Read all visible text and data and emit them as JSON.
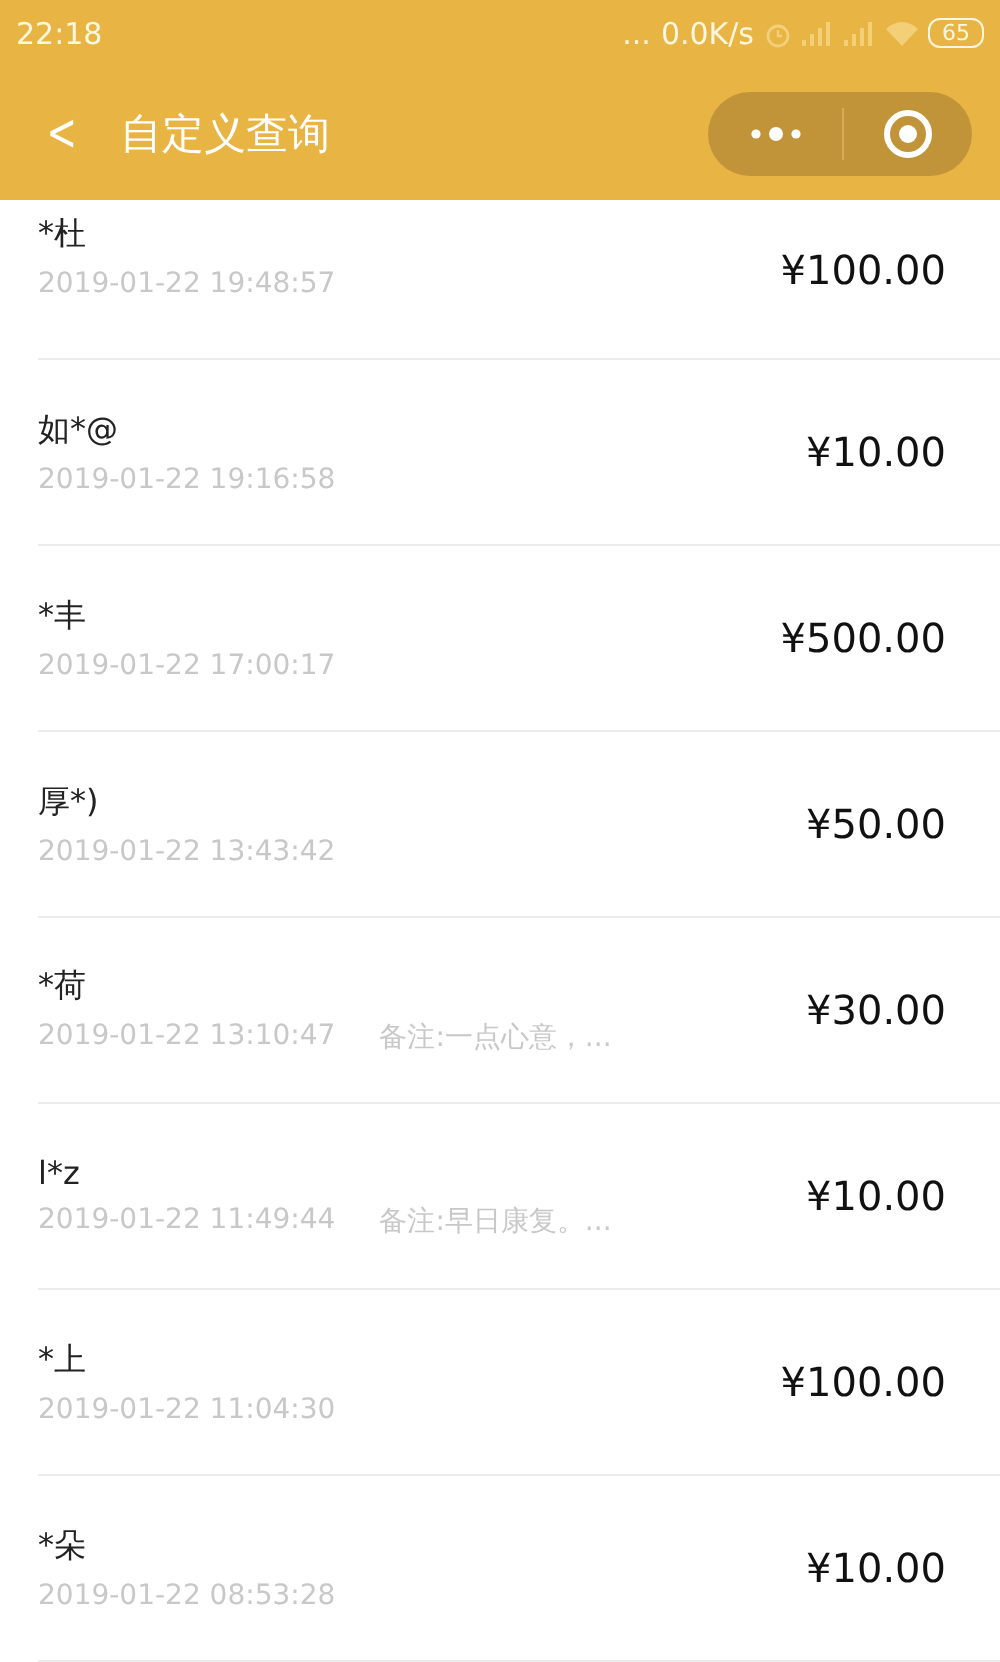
{
  "status_bar": {
    "time": "22:18",
    "dots": "...",
    "speed": "0.0K/s",
    "battery": "65"
  },
  "header": {
    "back": "<",
    "title": "自定义查询"
  },
  "records": [
    {
      "name": "*杜",
      "time": "2019-01-22 19:48:57",
      "amount": "¥100.00"
    },
    {
      "name": "如*@",
      "time": "2019-01-22 19:16:58",
      "amount": "¥10.00"
    },
    {
      "name": "*丰",
      "time": "2019-01-22 17:00:17",
      "amount": "¥500.00"
    },
    {
      "name": "厚*)",
      "time": "2019-01-22 13:43:42",
      "amount": "¥50.00"
    },
    {
      "name": "*荷",
      "time": "2019-01-22 13:10:47",
      "note": "备注:一点心意，...",
      "amount": "¥30.00"
    },
    {
      "name": "l*z",
      "time": "2019-01-22 11:49:44",
      "note": "备注:早日康复。...",
      "amount": "¥10.00"
    },
    {
      "name": "*上",
      "time": "2019-01-22 11:04:30",
      "amount": "¥100.00"
    },
    {
      "name": "*朵",
      "time": "2019-01-22 08:53:28",
      "amount": "¥10.00"
    }
  ]
}
